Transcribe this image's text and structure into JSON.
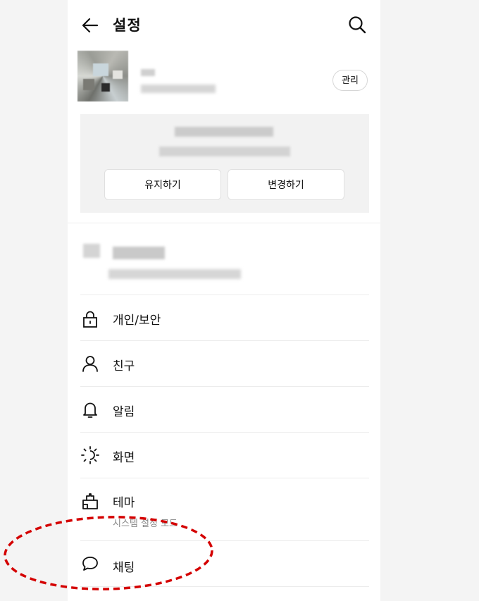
{
  "header": {
    "title": "설정",
    "back_icon": "arrow-left-icon",
    "search_icon": "search-icon"
  },
  "profile": {
    "manage_label": "관리"
  },
  "notice": {
    "keep_label": "유지하기",
    "change_label": "변경하기"
  },
  "menu": [
    {
      "icon": "lock-icon",
      "label": "개인/보안"
    },
    {
      "icon": "person-icon",
      "label": "친구"
    },
    {
      "icon": "bell-icon",
      "label": "알림"
    },
    {
      "icon": "brightness-icon",
      "label": "화면"
    },
    {
      "icon": "theme-icon",
      "label": "테마",
      "sub": "시스템 설정 모드"
    },
    {
      "icon": "chat-bubble-icon",
      "label": "채팅"
    }
  ],
  "colors": {
    "annotation": "#d40000",
    "panel_background": "#ffffff",
    "outer_background": "#f4f4f4"
  }
}
